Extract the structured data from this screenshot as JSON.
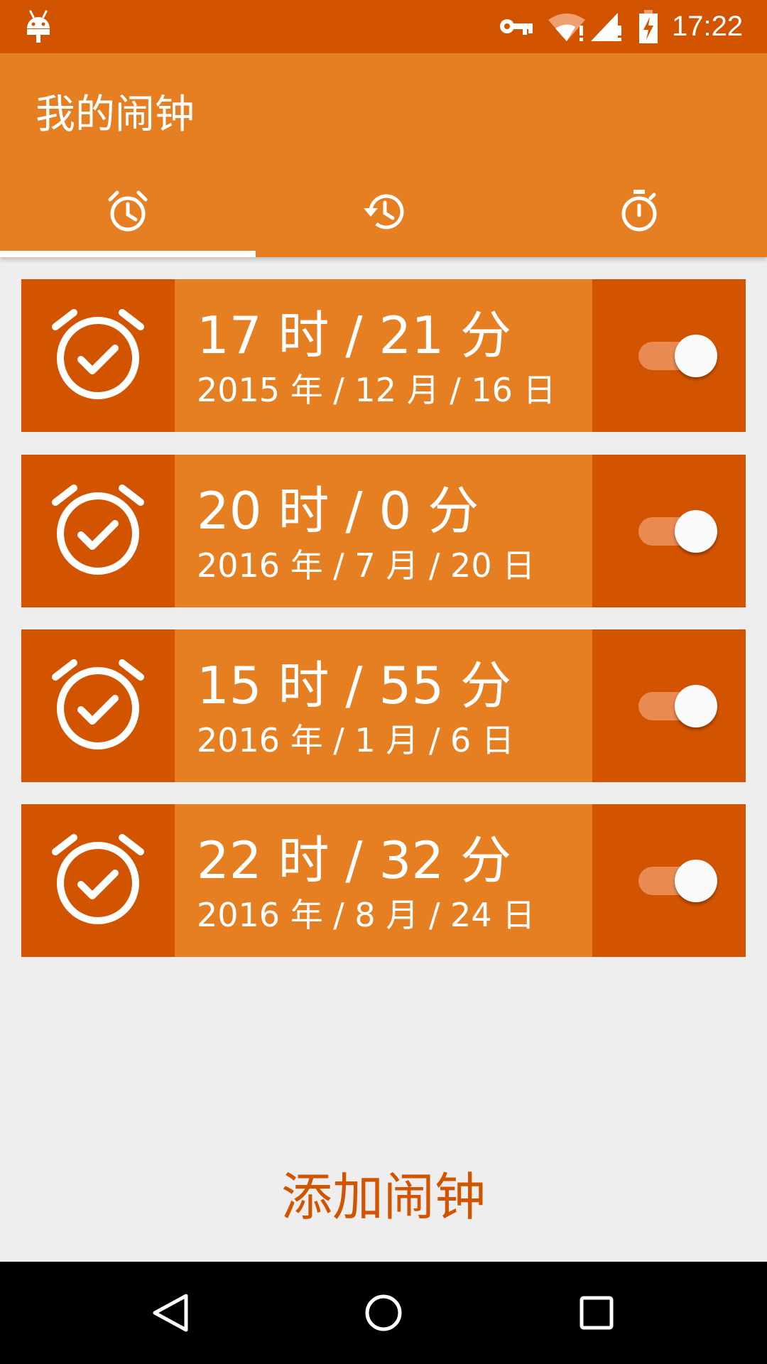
{
  "status_bar": {
    "time": "17:22",
    "icons": [
      "android-icon",
      "vpn-key-icon",
      "wifi-icon",
      "signal-icon",
      "battery-charging-icon"
    ]
  },
  "app_bar": {
    "title": "我的闹钟",
    "tabs": [
      {
        "icon": "alarm-icon",
        "selected": true
      },
      {
        "icon": "history-icon",
        "selected": false
      },
      {
        "icon": "timer-icon",
        "selected": false
      }
    ]
  },
  "alarms": [
    {
      "time": "17 时 / 21 分",
      "date": "2015 年 / 12 月 / 16 日",
      "enabled": true
    },
    {
      "time": "20 时 / 0 分",
      "date": "2016 年 / 7 月 / 20 日",
      "enabled": true
    },
    {
      "time": "15 时 / 55 分",
      "date": "2016 年 / 1 月 / 6 日",
      "enabled": true
    },
    {
      "time": "22 时 / 32 分",
      "date": "2016 年 / 8 月 / 24 日",
      "enabled": true
    }
  ],
  "add_button": {
    "label": "添加闹钟"
  },
  "nav_bar": {
    "buttons": [
      "back-icon",
      "home-icon",
      "recents-icon"
    ]
  },
  "colors": {
    "primary": "#E67E22",
    "primary_dark": "#D35400",
    "background": "#EEEEEE"
  }
}
